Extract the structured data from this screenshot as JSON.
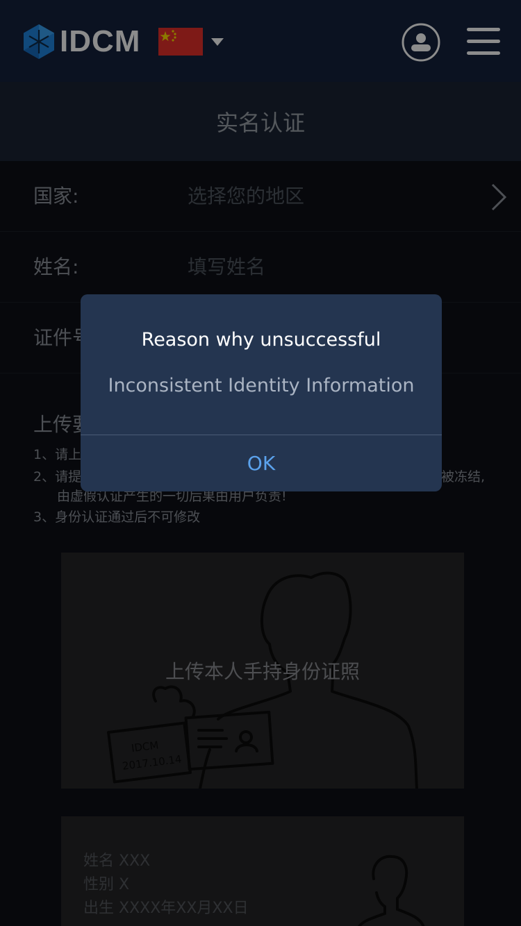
{
  "header": {
    "brand": "IDCM",
    "flag_icon": "china-flag-icon",
    "caret_icon": "caret-down-icon",
    "user_icon": "user-icon",
    "menu_icon": "hamburger-menu-icon"
  },
  "page_title": "实名认证",
  "form": {
    "country_label": "国家:",
    "country_placeholder": "选择您的地区",
    "name_label": "姓名:",
    "name_placeholder": "填写姓名",
    "id_label": "证件号"
  },
  "upload": {
    "section_title": "上传要",
    "notes": [
      "1、请上",
      "2、请提",
      "户被冻结,",
      "由虚假认证产生的一切后果由用户负责!",
      "3、身份认证通过后不可修改"
    ],
    "card1_caption": "上传本人手持身份证照",
    "card1_stamp": "IDCM",
    "card1_date": "2017.10.14",
    "card2_lines": [
      "姓名  XXX",
      "性别  X",
      "出生  XXXX年XX月XX日"
    ]
  },
  "dialog": {
    "title": "Reason why unsuccessful",
    "message": "Inconsistent Identity Information",
    "ok_label": "OK"
  },
  "colors": {
    "header_bg": "#15223d",
    "dialog_bg": "#243550",
    "ok_blue": "#5ba2ec"
  }
}
